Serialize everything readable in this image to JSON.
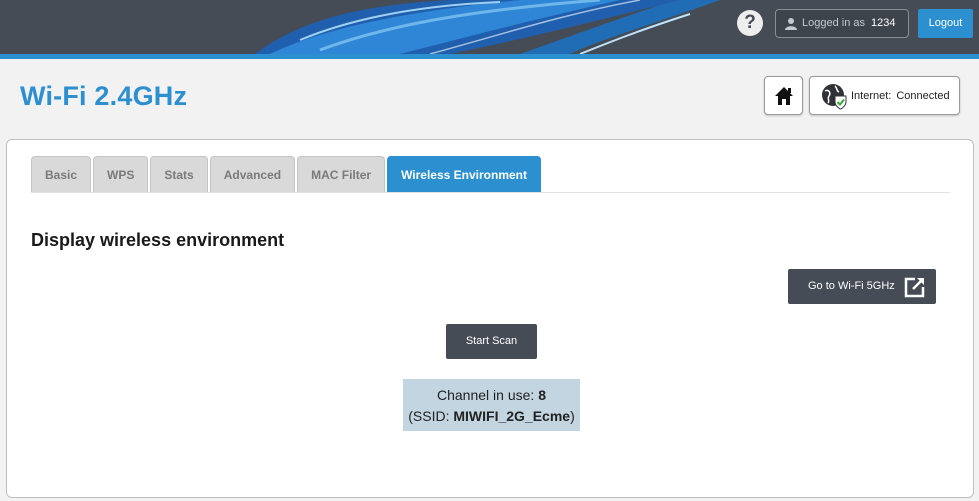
{
  "header": {
    "help_label": "?",
    "logged_in_label": "Logged in as",
    "username": "1234",
    "logout_label": "Logout",
    "colors": {
      "bar": "#454c55",
      "accent": "#2b8fd0"
    }
  },
  "title_row": {
    "page_title": "Wi-Fi 2.4GHz",
    "home_icon": "home-icon",
    "internet_label": "Internet:",
    "internet_status": "Connected"
  },
  "tabs": [
    {
      "label": "Basic",
      "active": false
    },
    {
      "label": "WPS",
      "active": false
    },
    {
      "label": "Stats",
      "active": false
    },
    {
      "label": "Advanced",
      "active": false
    },
    {
      "label": "MAC Filter",
      "active": false
    },
    {
      "label": "Wireless Environment",
      "active": true
    }
  ],
  "main": {
    "section_title": "Display wireless environment",
    "goto_label": "Go to Wi-Fi 5GHz",
    "goto_icon": "external-link-icon",
    "scan_label": "Start Scan",
    "channel_label": "Channel in use:",
    "channel_value": "8",
    "ssid_open": "(SSID:",
    "ssid_value": "MIWIFI_2G_Ecme",
    "ssid_close": ")"
  }
}
